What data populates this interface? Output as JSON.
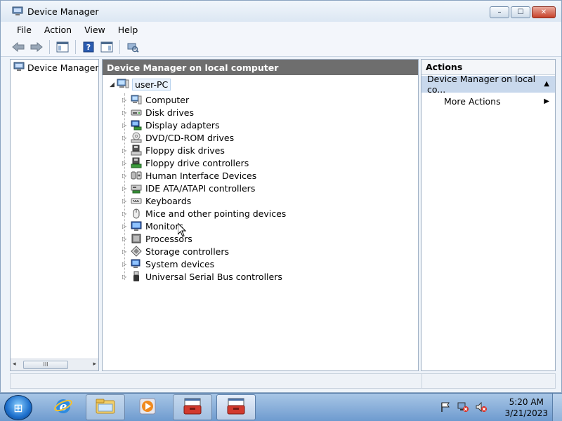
{
  "window": {
    "title": "Device Manager",
    "controls": {
      "minimize": "–",
      "maximize": "☐",
      "close": "✕"
    }
  },
  "menu": [
    "File",
    "Action",
    "View",
    "Help"
  ],
  "toolbar": {
    "icons": [
      "back-arrow-icon",
      "forward-arrow-icon",
      "show-hide-console-tree-icon",
      "help-icon",
      "show-hide-action-pane-icon",
      "scan-hardware-icon"
    ]
  },
  "left_pane": {
    "item": "Device Manager or",
    "scroll_thumb": "III",
    "scroll_left": "◂",
    "scroll_right": "▸"
  },
  "center_pane": {
    "header": "Device Manager on local computer",
    "root": {
      "label": "user-PC",
      "expander": "◢"
    },
    "nodes": [
      {
        "label": "Computer",
        "icon": "computer-icon"
      },
      {
        "label": "Disk drives",
        "icon": "disk-drive-icon"
      },
      {
        "label": "Display adapters",
        "icon": "display-adapter-icon"
      },
      {
        "label": "DVD/CD-ROM drives",
        "icon": "dvd-drive-icon"
      },
      {
        "label": "Floppy disk drives",
        "icon": "floppy-drive-icon"
      },
      {
        "label": "Floppy drive controllers",
        "icon": "floppy-controller-icon"
      },
      {
        "label": "Human Interface Devices",
        "icon": "hid-icon"
      },
      {
        "label": "IDE ATA/ATAPI controllers",
        "icon": "ide-controller-icon"
      },
      {
        "label": "Keyboards",
        "icon": "keyboard-icon"
      },
      {
        "label": "Mice and other pointing devices",
        "icon": "mouse-icon"
      },
      {
        "label": "Monitors",
        "icon": "monitor-icon"
      },
      {
        "label": "Processors",
        "icon": "processor-icon"
      },
      {
        "label": "Storage controllers",
        "icon": "storage-controller-icon"
      },
      {
        "label": "System devices",
        "icon": "system-devices-icon"
      },
      {
        "label": "Universal Serial Bus controllers",
        "icon": "usb-icon"
      }
    ],
    "expander": "▷"
  },
  "actions_pane": {
    "header": "Actions",
    "section": "Device Manager on local co...",
    "section_caret": "▲",
    "more_actions": "More Actions",
    "more_arrow": "▶"
  },
  "taskbar": {
    "start": "⊞",
    "apps": [
      {
        "name": "windows-explorer-icon",
        "state": "normal"
      },
      {
        "name": "internet-explorer-icon",
        "state": "normal"
      },
      {
        "name": "folder-icon",
        "state": "open"
      },
      {
        "name": "media-player-icon",
        "state": "normal"
      },
      {
        "name": "toolbox-icon",
        "state": "open"
      },
      {
        "name": "toolbox-icon",
        "state": "active"
      }
    ],
    "clock": {
      "time": "5:20 AM",
      "date": "3/21/2023"
    }
  },
  "colors": {
    "pane_header_bg": "#6e6e6e",
    "actions_section_bg": "#c8d8ec",
    "taskbar_top": "#a8c6e6",
    "taskbar_bottom": "#6e9bcf"
  }
}
